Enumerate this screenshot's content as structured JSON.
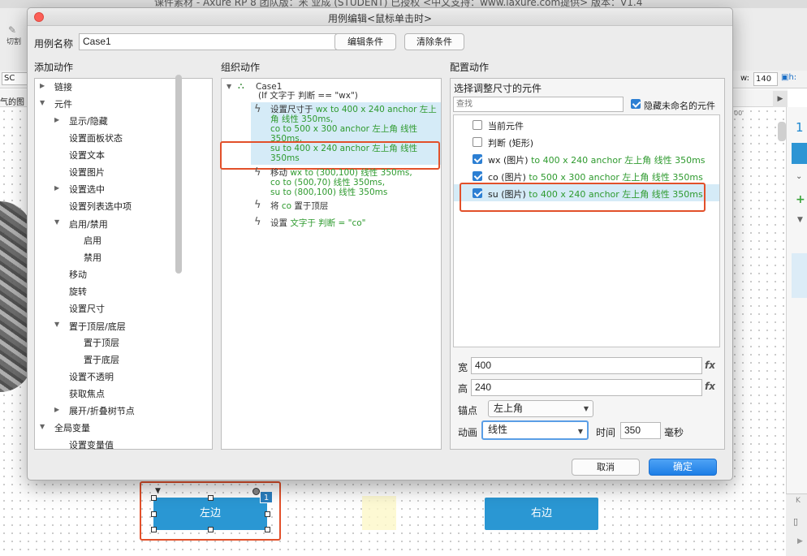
{
  "app": {
    "title": "课件素材 - Axure RP 8 团队版：米 业成 (STUDENT) 已授权     <中文支持：www.iaxure.com提供> 版本：V1.4",
    "toolbar_cut": "切割",
    "prop_sc": "SC",
    "w_label": "w:",
    "w_value": "140",
    "h_label": "h:",
    "tab_text": "气的图",
    "ruler_value": "00",
    "canvas_left_button": "左边",
    "canvas_right_button": "右边",
    "badge_number": "1",
    "right_panel_number": "1",
    "right_panel_k": "K"
  },
  "dialog": {
    "title": "用例编辑<鼠标单击时>",
    "case_name_label": "用例名称",
    "case_name_value": "Case1",
    "edit_condition_button": "编辑条件",
    "clear_condition_button": "清除条件",
    "add_action_title": "添加动作",
    "organize_action_title": "组织动作",
    "config_action_title": "配置动作",
    "add_action_tree": [
      "链接",
      "元件",
      "显示/隐藏",
      "设置面板状态",
      "设置文本",
      "设置图片",
      "设置选中",
      "设置列表选中项",
      "启用/禁用",
      "启用",
      "禁用",
      "移动",
      "旋转",
      "设置尺寸",
      "置于顶层/底层",
      "置于顶层",
      "置于底层",
      "设置不透明",
      "获取焦点",
      "展开/折叠树节点",
      "全局变量",
      "设置变量值"
    ],
    "organize": {
      "case_name": "Case1",
      "case_condition": "(If 文字于 判断 == \"wx\")",
      "a1_prefix": "设置尺寸于 ",
      "a1_l1_green": "wx to 400 x 240 anchor 左上",
      "a1_l2": "角 线性 350ms,",
      "a1_l3": "co to 500 x 300 anchor 左上角 线性",
      "a1_l4": "350ms,",
      "a1_l5": "su to 400 x 240 anchor 左上角 线性",
      "a1_l6": "350ms",
      "a2_prefix": "移动 ",
      "a2_l1": "wx to (300,100) 线性 350ms,",
      "a2_l2": "co to (500,70) 线性 350ms,",
      "a2_l3": "su to (800,100) 线性 350ms",
      "a3_prefix": "将 ",
      "a3_green": "co",
      "a3_suffix": " 置于顶层",
      "a4_prefix": "设置 ",
      "a4_green": "文字于 判断 = \"co\""
    },
    "config": {
      "select_title": "选择调整尺寸的元件",
      "search_placeholder": "查找",
      "hide_unnamed_label": "隐藏未命名的元件",
      "rows": [
        {
          "name": "当前元件",
          "detail": "",
          "checked": false
        },
        {
          "name": "判断 (矩形)",
          "detail": "",
          "checked": false
        },
        {
          "name": "wx (图片)",
          "detail": " to 400 x 240 anchor 左上角 线性 350ms",
          "checked": true
        },
        {
          "name": "co (图片)",
          "detail": " to 500 x 300 anchor 左上角 线性 350ms",
          "checked": true
        },
        {
          "name": "su (图片)",
          "detail": " to 400 x 240 anchor 左上角 线性 350ms",
          "checked": true
        }
      ],
      "width_label": "宽",
      "width_value": "400",
      "height_label": "高",
      "height_value": "240",
      "fx": "fx",
      "anchor_label": "锚点",
      "anchor_value": "左上角",
      "animation_label": "动画",
      "animation_value": "线性",
      "time_label": "时间",
      "time_value": "350",
      "time_unit": "毫秒"
    },
    "cancel_button": "取消",
    "ok_button": "确定"
  },
  "colors": {
    "accent": "#2a97d3",
    "highlight_red": "#e2502a",
    "green_text": "#2e9a2e",
    "selection": "#d5ebf7"
  }
}
